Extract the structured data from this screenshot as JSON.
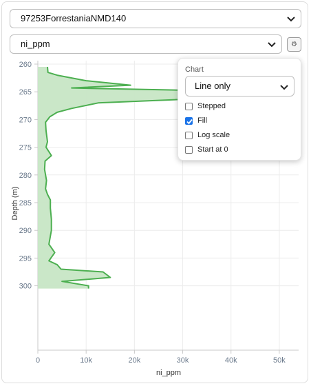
{
  "well_select": {
    "value": "97253ForrestaniaNMD140"
  },
  "variable_select": {
    "value": "ni_ppm"
  },
  "settings_button": {
    "icon": "gear-icon",
    "glyph": "⚙"
  },
  "chart_settings": {
    "title": "Chart",
    "style_value": "Line only",
    "options": [
      {
        "label": "Stepped",
        "checked": false
      },
      {
        "label": "Fill",
        "checked": true
      },
      {
        "label": "Log scale",
        "checked": false
      },
      {
        "label": "Start at 0",
        "checked": false
      }
    ]
  },
  "chart_data": {
    "type": "area",
    "orientation": "vertical-depth",
    "xlabel": "ni_ppm",
    "ylabel": "Depth (m)",
    "xlim": [
      0,
      54000
    ],
    "ylim": [
      260,
      300.5
    ],
    "x_ticks": [
      "0",
      "10k",
      "20k",
      "30k",
      "40k",
      "50k"
    ],
    "y_ticks": [
      "260",
      "265",
      "270",
      "275",
      "280",
      "285",
      "290",
      "295",
      "300"
    ],
    "grid": true,
    "fill": true,
    "color": "#4caf50",
    "fill_color": "#c7e6c5",
    "series": [
      {
        "depth": [
          260.5,
          261.5,
          262.0,
          263.0,
          263.8,
          264.3,
          265.0,
          266.0,
          267.0,
          268.0,
          268.7,
          269.5,
          270.5,
          272.0,
          274.0,
          275.0,
          276.5,
          277.5,
          279.0,
          281.0,
          282.5,
          283.5,
          284.5,
          286.0,
          288.0,
          290.0,
          292.5,
          294.0,
          295.5,
          296.2,
          297.0,
          297.5,
          298.5,
          299.2,
          300.0,
          300.5
        ],
        "ni_ppm": [
          2000,
          2100,
          4000,
          10000,
          19200,
          7000,
          46000,
          40000,
          12500,
          7000,
          4000,
          2500,
          1600,
          1700,
          2000,
          1700,
          2800,
          1500,
          1400,
          1800,
          1600,
          2000,
          2600,
          2600,
          2800,
          2800,
          2300,
          3500,
          2300,
          4000,
          4800,
          13500,
          15000,
          5000,
          10500,
          10500
        ]
      }
    ]
  }
}
